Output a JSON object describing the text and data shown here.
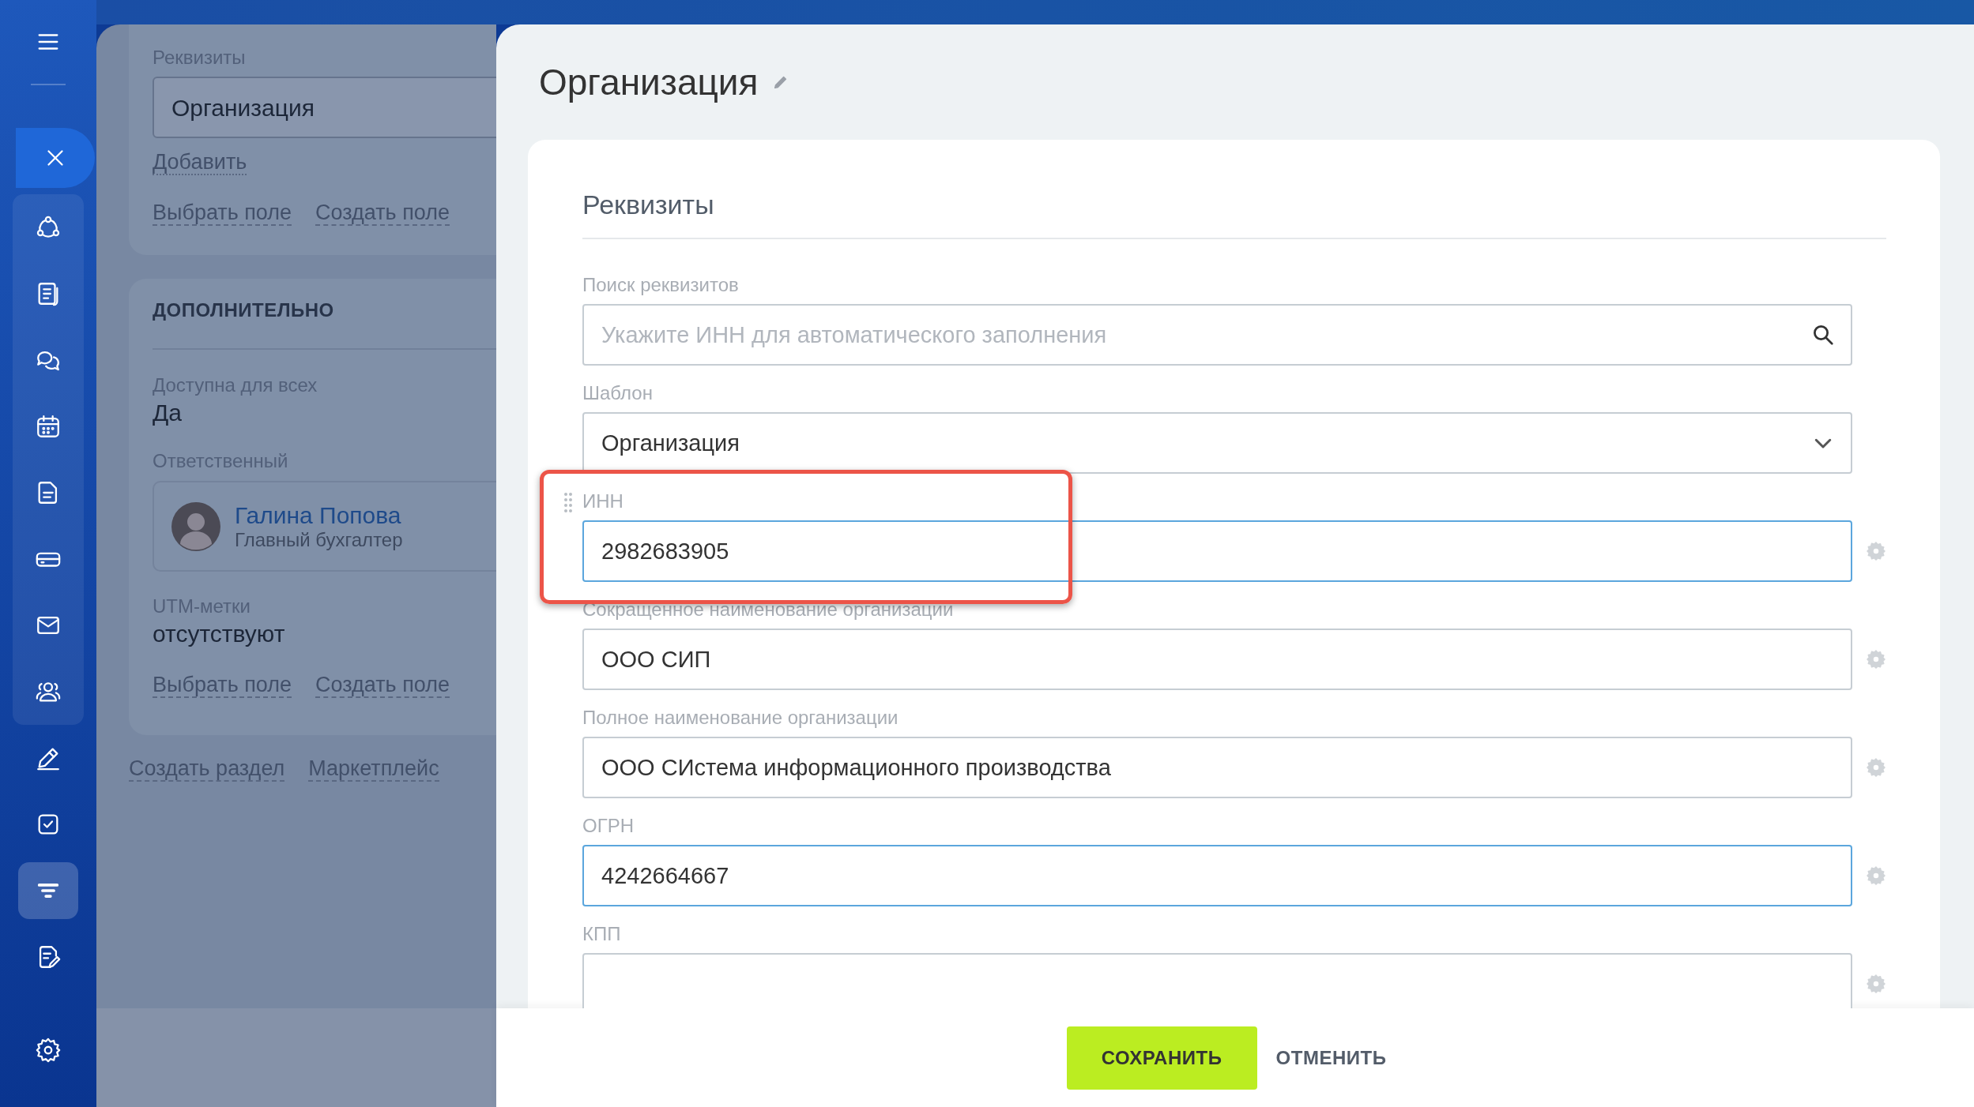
{
  "sidebar": {
    "items": [
      {
        "selected": false
      },
      {
        "selected": false
      },
      {
        "selected": false
      },
      {
        "selected": false
      },
      {
        "selected": false
      },
      {
        "selected": false
      },
      {
        "selected": false
      },
      {
        "selected": false
      },
      {
        "selected": false
      },
      {
        "selected": false
      },
      {
        "selected": true
      },
      {
        "selected": false
      }
    ]
  },
  "background_form": {
    "section_1": {
      "label": "Реквизиты",
      "value": "Организация",
      "add_link": "Добавить",
      "links": [
        "Выбрать поле",
        "Создать поле"
      ]
    },
    "section_2": {
      "title": "ДОПОЛНИТЕЛЬНО",
      "available_label": "Доступна для всех",
      "available_value": "Да",
      "responsible_label": "Ответственный",
      "person": {
        "name": "Галина Попова",
        "position": "Главный бухгалтер"
      },
      "utm_label": "UTM-метки",
      "utm_value": "отсутствуют",
      "links": [
        "Выбрать поле",
        "Создать поле"
      ]
    },
    "footer_links": [
      "Создать раздел",
      "Маркетплейс"
    ]
  },
  "panel": {
    "title": "Организация",
    "section_title": "Реквизиты",
    "fields": [
      {
        "kind": "search",
        "label": "Поиск реквизитов",
        "placeholder": "Укажите ИНН для автоматического заполнения",
        "focused": false,
        "annotated": false
      },
      {
        "kind": "select",
        "label": "Шаблон",
        "value": "Организация",
        "focused": false,
        "annotated": false
      },
      {
        "kind": "text",
        "label": "ИНН",
        "value": "2982683905",
        "focused": true,
        "annotated": true
      },
      {
        "kind": "text",
        "label": "Сокращенное наименование организации",
        "value": "ООО СИП",
        "focused": false,
        "annotated": false
      },
      {
        "kind": "text",
        "label": "Полное наименование организации",
        "value": "ООО СИстема информационного производства",
        "focused": false,
        "annotated": false
      },
      {
        "kind": "text",
        "label": "ОГРН",
        "value": "4242664667",
        "focused": true,
        "annotated": false
      },
      {
        "kind": "text",
        "label": "КПП",
        "focused": false,
        "annotated": false
      }
    ],
    "buttons": [
      {
        "kind": "primary",
        "label": "СОХРАНИТЬ"
      },
      {
        "kind": "link",
        "label": "ОТМЕНИТЬ"
      }
    ]
  }
}
